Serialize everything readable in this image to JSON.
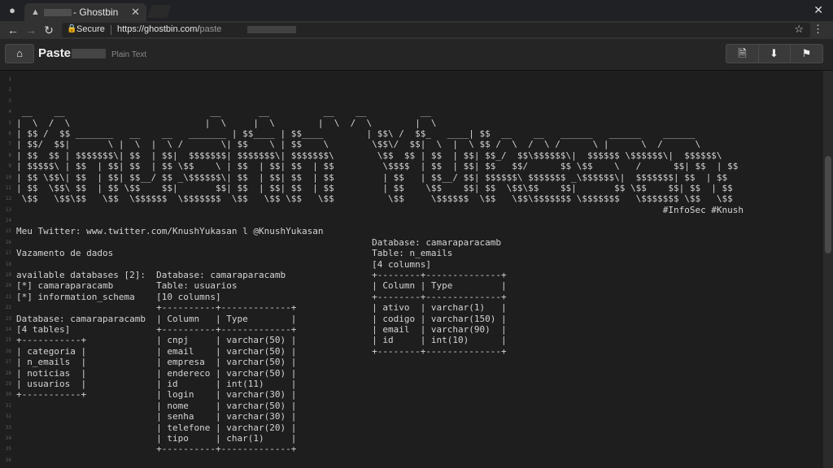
{
  "browser": {
    "tab_title": "- Ghostbin",
    "incognito_icon": "incognito-icon",
    "secure_label": "Secure",
    "url_main": "https://ghostbin.com/",
    "url_path": "paste"
  },
  "header": {
    "title": "Paste",
    "language": "Plain Text"
  },
  "lines": [
    "",
    "",
    "",
    " __    __                           __       __          __    __          __",
    "|  \\  /  \\                         |  \\     |  \\        |  \\  /  \\        |  \\",
    "| $$ /  $$ _______   __    __   _______ | $$____ | $$____        | $$\\ /  $$_   ____| $$  __    __   ______   ______    ______",
    "| $$/  $$|       \\ |  \\  |  \\ /       \\| $$    \\ | $$    \\        \\$$\\/  $$|  \\  |  \\ $$ /  \\  /  \\ /      \\ |      \\  /      \\",
    "| $$  $$ | $$$$$$$\\| $$  | $$|  $$$$$$$| $$$$$$$\\| $$$$$$$\\        \\$$  $$ | $$  | $$| $$_/  $$\\$$$$$$\\|  $$$$$$ \\$$$$$$\\|  $$$$$$\\",
    "| $$$$$\\ | $$  | $$| $$  | $$ \\$$    \\ | $$  | $$| $$  | $$         \\$$$$  | $$  | $$| $$   $$/      $$ \\$$    \\   /      $$| $$  | $$",
    "| $$ \\$$\\| $$  | $$| $$__/ $$ _\\$$$$$$\\| $$  | $$| $$  | $$         | $$   | $$__/ $$| $$$$$$\\ $$$$$$$ _\\$$$$$$\\|  $$$$$$$| $$  | $$",
    "| $$  \\$$\\ $$  | $$ \\$$    $$|       $$| $$  | $$| $$  | $$         | $$    \\$$    $$| $$  \\$$\\$$    $$|       $$ \\$$    $$| $$  | $$",
    " \\$$   \\$$\\$$   \\$$  \\$$$$$$  \\$$$$$$$  \\$$   \\$$ \\$$   \\$$          \\$$     \\$$$$$$  \\$$   \\$$\\$$$$$$$ \\$$$$$$$   \\$$$$$$$ \\$$   \\$$",
    "                                                                                                                        #InfoSec #Knush",
    "",
    "Meu Twitter: www.twitter.com/KnushYukasan l @KnushYukasan",
    "                                                                  Database: camaraparacamb",
    "Vazamento de dados                                                Table: n_emails",
    "                                                                  [4 columns]",
    "available databases [2]:  Database: camaraparacamb                +--------+--------------+",
    "[*] camaraparacamb        Table: usuarios                         | Column | Type         |",
    "[*] information_schema    [10 columns]                            +--------+--------------+",
    "                          +----------+-------------+              | ativo  | varchar(1)   |",
    "Database: camaraparacamb  | Column   | Type        |              | codigo | varchar(150) |",
    "[4 tables]                +----------+-------------+              | email  | varchar(90)  |",
    "+-----------+             | cnpj     | varchar(50) |              | id     | int(10)      |",
    "| categoria |             | email    | varchar(50) |              +--------+--------------+",
    "| n_emails  |             | empresa  | varchar(50) |",
    "| noticias  |             | endereco | varchar(50) |",
    "| usuarios  |             | id       | int(11)     |",
    "+-----------+             | login    | varchar(30) |",
    "                          | nome     | varchar(50) |",
    "                          | senha    | varchar(30) |",
    "                          | telefone | varchar(20) |",
    "                          | tipo     | char(1)     |",
    "                          +----------+-------------+",
    "",
    "+-----------------------------------------------------------------------------------------------------------------------------------------------+"
  ]
}
